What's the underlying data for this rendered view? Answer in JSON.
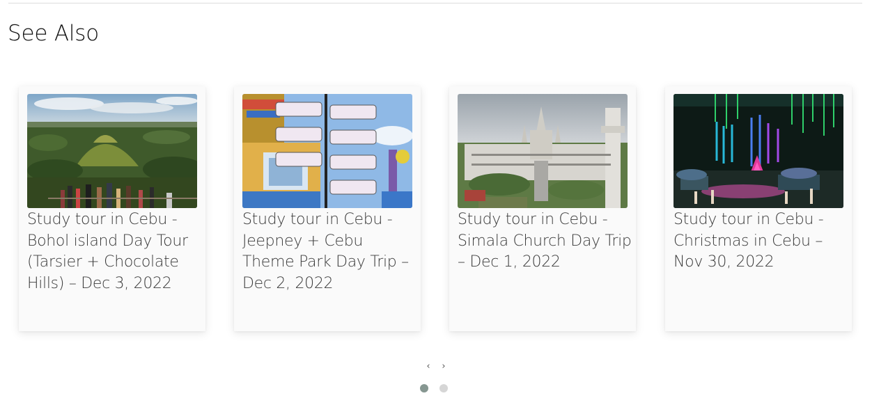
{
  "section": {
    "title": "See Also"
  },
  "cards": [
    {
      "title": "Study tour in Cebu - Bohol island Day Tour (Tarsier + Chocolate Hills) – Dec 3, 2022",
      "image": "chocolate-hills-photo"
    },
    {
      "title": "Study tour in Cebu - Jeepney + Cebu Theme Park Day Trip – Dec 2, 2022",
      "image": "theme-park-signpost-photo"
    },
    {
      "title": "Study tour in Cebu - Simala Church Day Trip – Dec 1, 2022",
      "image": "simala-church-photo"
    },
    {
      "title": "Study tour in Cebu - Christmas in Cebu – Nov 30, 2022",
      "image": "christmas-lights-photo"
    }
  ],
  "navigation": {
    "prev_label": "‹",
    "next_label": "›",
    "pages": 2,
    "active_page": 1
  },
  "colors": {
    "dot_active": "#869791",
    "dot_inactive": "#d6d6d6"
  }
}
